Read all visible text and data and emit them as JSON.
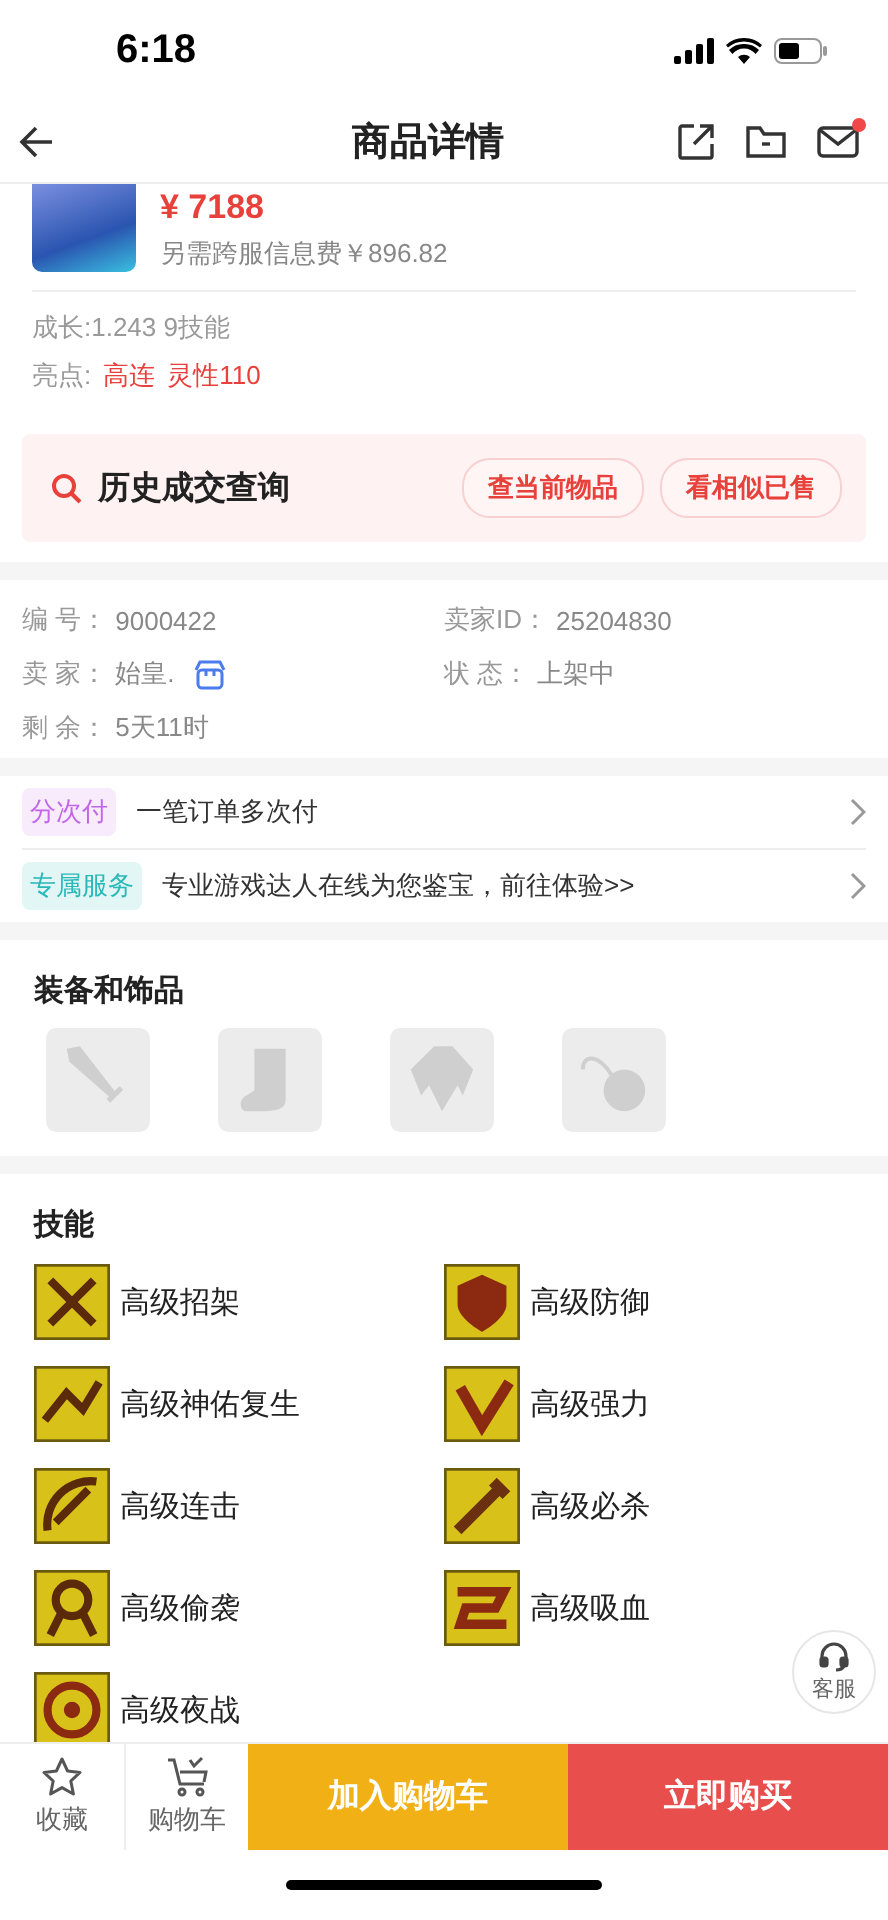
{
  "status_bar": {
    "time": "6:18"
  },
  "header": {
    "title": "商品详情"
  },
  "product": {
    "price": "¥ 7188",
    "fee": "另需跨服信息费￥896.82",
    "growth": "成长:1.243 9技能",
    "highlights_label": "亮点:",
    "highlights": [
      "高连",
      "灵性110"
    ]
  },
  "history": {
    "title": "历史成交查询",
    "buttons": [
      "查当前物品",
      "看相似已售"
    ]
  },
  "info": [
    {
      "label": "编 号：",
      "value": "9000422",
      "shop_icon": false
    },
    {
      "label": "卖家ID：",
      "value": "25204830",
      "shop_icon": false
    },
    {
      "label": "卖 家：",
      "value": "始皇.",
      "shop_icon": true
    },
    {
      "label": "状 态：",
      "value": "上架中",
      "shop_icon": false
    },
    {
      "label": "剩 余：",
      "value": "5天11时",
      "shop_icon": false
    }
  ],
  "services": [
    {
      "tag": "分次付",
      "text": "一笔订单多次付",
      "color": "#c266e8"
    },
    {
      "tag": "专属服务",
      "text": "专业游戏达人在线为您鉴宝，前往体验>>",
      "color": "#2bb8b8"
    }
  ],
  "equipment": {
    "title": "装备和饰品",
    "slots": [
      {
        "kind": "weapon"
      },
      {
        "kind": "boots"
      },
      {
        "kind": "armor"
      },
      {
        "kind": "accessory"
      }
    ]
  },
  "skills": {
    "title": "技能",
    "items": [
      {
        "name": "高级招架"
      },
      {
        "name": "高级防御"
      },
      {
        "name": "高级神佑复生"
      },
      {
        "name": "高级强力"
      },
      {
        "name": "高级连击"
      },
      {
        "name": "高级必杀"
      },
      {
        "name": "高级偷袭"
      },
      {
        "name": "高级吸血"
      },
      {
        "name": "高级夜战"
      }
    ]
  },
  "support": {
    "label": "客服"
  },
  "bottom_bar": {
    "favorite": "收藏",
    "cart": "购物车",
    "add_to_cart": "加入购物车",
    "buy_now": "立即购买"
  }
}
